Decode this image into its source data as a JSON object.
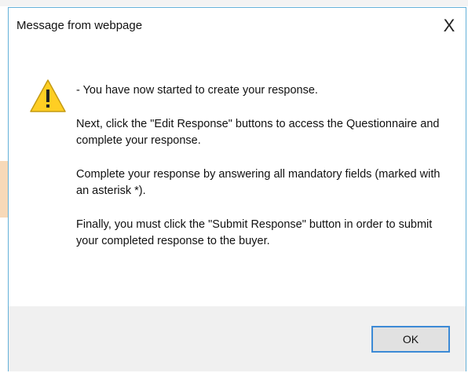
{
  "dialog": {
    "title": "Message from webpage",
    "close_glyph": "X",
    "icon": "warning-icon",
    "messages": [
      "- You have now started to create your response.",
      "Next, click the \"Edit Response\" buttons to access the Questionnaire and complete your response.",
      "Complete your response by answering all mandatory fields (marked with an asterisk *).",
      "Finally, you must click the \"Submit Response\" button in order to submit your completed response to the buyer."
    ],
    "ok_label": "OK"
  },
  "colors": {
    "dialog_border": "#63b0d8",
    "footer_bg": "#f0f0f0",
    "button_focus": "#3c8ad6",
    "warning_fill": "#ffce23"
  }
}
